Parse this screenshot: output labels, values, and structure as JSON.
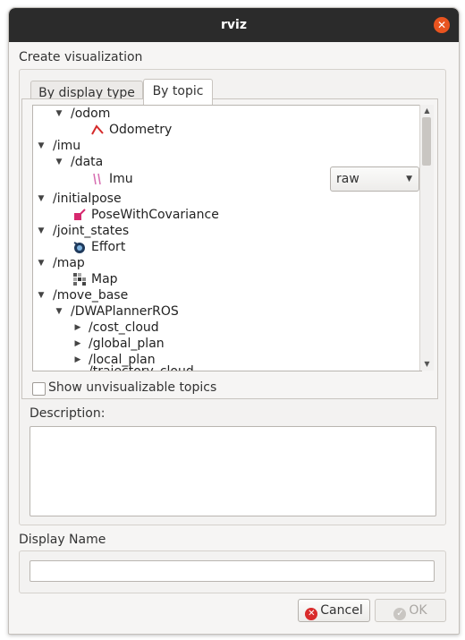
{
  "window": {
    "title": "rviz",
    "close_icon": "✕"
  },
  "create_visualization": {
    "label": "Create visualization",
    "tabs": [
      {
        "label": "By display type"
      },
      {
        "label": "By topic"
      }
    ],
    "tree": {
      "rows": [
        {
          "text": "/odom"
        },
        {
          "text": "Odometry",
          "icon": "odometry-icon"
        },
        {
          "text": "/imu"
        },
        {
          "text": "/data"
        },
        {
          "text": "Imu",
          "icon": "imu-icon"
        },
        {
          "text": "/initialpose"
        },
        {
          "text": "PoseWithCovariance",
          "icon": "pose-icon"
        },
        {
          "text": "/joint_states"
        },
        {
          "text": "Effort",
          "icon": "effort-icon"
        },
        {
          "text": "/map"
        },
        {
          "text": "Map",
          "icon": "map-icon"
        },
        {
          "text": "/move_base"
        },
        {
          "text": "/DWAPlannerROS"
        },
        {
          "text": "/cost_cloud"
        },
        {
          "text": "/global_plan"
        },
        {
          "text": "/local_plan"
        },
        {
          "text": "/trajectory_cloud"
        }
      ],
      "imu_dropdown_value": "raw"
    },
    "show_unvisualizable_label": "Show unvisualizable topics",
    "description_label": "Description:"
  },
  "display_name": {
    "label": "Display Name",
    "value": ""
  },
  "buttons": {
    "cancel_label": "Cancel",
    "ok_label": "OK"
  },
  "colors": {
    "titlebar": "#2b2b2b",
    "close": "#e9541f",
    "cancel_icon": "#d92b2b"
  }
}
